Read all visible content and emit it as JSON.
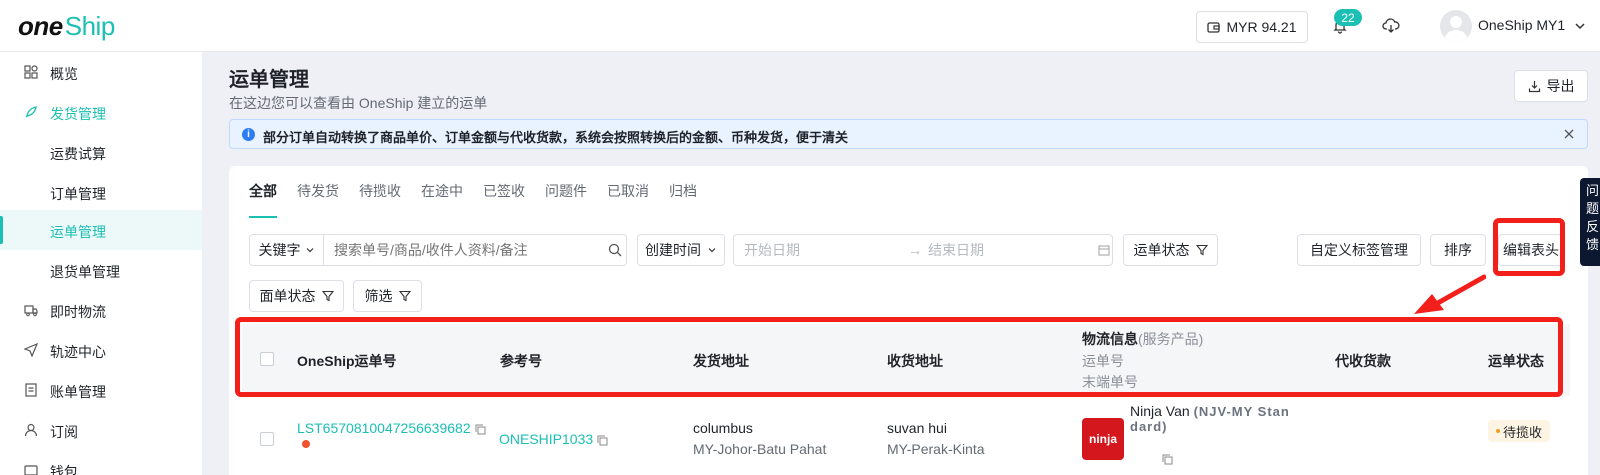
{
  "brand": {
    "one": "one",
    "ship": "Ship",
    "accent": "#1bbfb3"
  },
  "header": {
    "balance": "MYR 94.21",
    "notifications": "22",
    "user": "OneShip MY1"
  },
  "sidebar": {
    "items": [
      {
        "label": "概览",
        "icon": "dashboard-icon"
      },
      {
        "label": "发货管理",
        "icon": "rocket-icon"
      },
      {
        "label": "运费试算"
      },
      {
        "label": "订单管理"
      },
      {
        "label": "运单管理"
      },
      {
        "label": "退货单管理"
      },
      {
        "label": "即时物流",
        "icon": "truck-icon"
      },
      {
        "label": "轨迹中心",
        "icon": "send-icon"
      },
      {
        "label": "账单管理",
        "icon": "bill-icon"
      },
      {
        "label": "订阅",
        "icon": "user-icon"
      },
      {
        "label": "钱包",
        "icon": "wallet-icon"
      }
    ]
  },
  "page": {
    "title": "运单管理",
    "description": "在这边您可以查看由 OneShip 建立的运单",
    "export_label": "导出",
    "notice": "部分订单自动转换了商品单价、订单金额与代收货款，系统会按照转换后的金额、币种发货，便于清关"
  },
  "tabs": [
    "全部",
    "待发货",
    "待揽收",
    "在途中",
    "已签收",
    "问题件",
    "已取消",
    "归档"
  ],
  "filters": {
    "keyword_label": "关键字",
    "search_placeholder": "搜索单号/商品/收件人资料/备注",
    "time_label": "创建时间",
    "start_placeholder": "开始日期",
    "end_placeholder": "结束日期",
    "waybill_status": "运单状态",
    "custom_tags": "自定义标签管理",
    "sort": "排序",
    "edit_columns": "编辑表头",
    "label_status": "面单状态",
    "filter": "筛选"
  },
  "table": {
    "columns": {
      "waybill": "OneShip运单号",
      "reference": "参考号",
      "sender": "发货地址",
      "receiver": "收货地址",
      "logistics": "物流信息",
      "logistics_note": "(服务产品)",
      "tracking_no": "运单号",
      "last_mile": "末端单号",
      "cod": "代收货款",
      "status": "运单状态"
    },
    "rows": [
      {
        "waybill": "LST6570810047256639682",
        "reference": "ONESHIP1033",
        "sender_name": "columbus",
        "sender_region": "MY-Johor-Batu Pahat",
        "receiver_name": "suvan hui",
        "receiver_region": "MY-Perak-Kinta",
        "carrier": "Ninja Van",
        "service_line1": "(NJV-MY Stan",
        "service_line2": "dard)",
        "carrier_logo_text": "ninja",
        "status": "待揽收"
      }
    ]
  },
  "side_tab": {
    "line1": "问",
    "line2": "题",
    "line3": "反",
    "line4": "馈"
  }
}
